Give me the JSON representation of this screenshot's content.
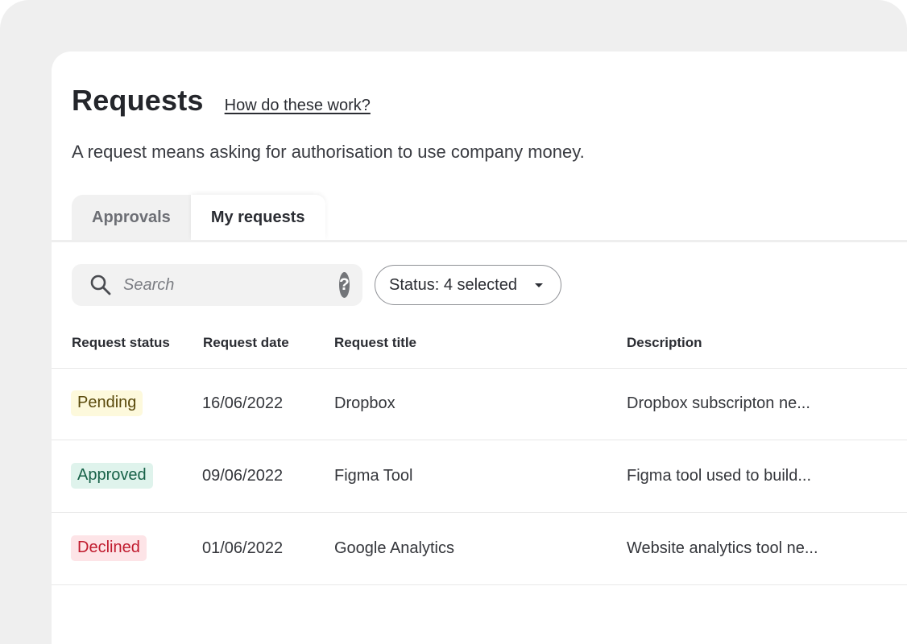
{
  "header": {
    "title": "Requests",
    "help_link": "How do these work?",
    "subtitle": "A request means asking for authorisation to use company money."
  },
  "tabs": [
    {
      "label": "Approvals",
      "active": false
    },
    {
      "label": "My requests",
      "active": true
    }
  ],
  "search": {
    "placeholder": "Search",
    "value": "",
    "help_icon_glyph": "?"
  },
  "filter": {
    "label": "Status: 4 selected"
  },
  "table": {
    "columns": [
      "Request status",
      "Request date",
      "Request title",
      "Description"
    ],
    "rows": [
      {
        "status": "Pending",
        "date": "16/06/2022",
        "title": "Dropbox",
        "description": "Dropbox subscripton ne..."
      },
      {
        "status": "Approved",
        "date": "09/06/2022",
        "title": "Figma Tool",
        "description": "Figma tool used to build..."
      },
      {
        "status": "Declined",
        "date": "01/06/2022",
        "title": "Google Analytics",
        "description": "Website analytics tool ne..."
      }
    ]
  },
  "colors": {
    "pending_bg": "#fdf9dc",
    "pending_text": "#5a4a0c",
    "approved_bg": "#dff3ec",
    "approved_text": "#176148",
    "declined_bg": "#fde4e7",
    "declined_text": "#c01b2e",
    "outer_bg": "#efefef",
    "card_bg": "#ffffff"
  },
  "icons": {
    "search": "search-icon",
    "help": "help-icon",
    "caret": "caret-down-icon"
  }
}
